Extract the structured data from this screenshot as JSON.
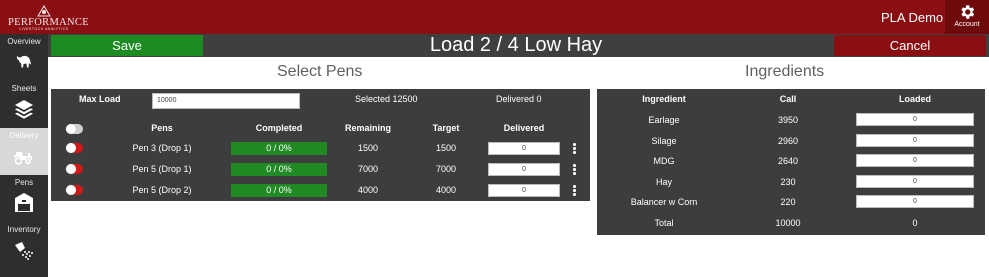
{
  "header": {
    "logo_text": "PERFORMANCE",
    "logo_sub": "LIVESTOCK ANALYTICS",
    "user_name": "PLA Demo",
    "account_label": "Account"
  },
  "sidebar": {
    "items": [
      {
        "label": "Overview",
        "icon": "bull-icon"
      },
      {
        "label": "Sheets",
        "icon": "layers-icon"
      },
      {
        "label": "Delivery",
        "icon": "tractor-icon",
        "active": true
      },
      {
        "label": "Pens",
        "icon": "barn-icon"
      },
      {
        "label": "Inventory",
        "icon": "grain-scoop-icon"
      }
    ]
  },
  "actionbar": {
    "save_label": "Save",
    "title": "Load 2 / 4 Low Hay",
    "cancel_label": "Cancel"
  },
  "pens_section": {
    "title": "Select Pens",
    "max_load_label": "Max Load",
    "max_load_value": "10000",
    "selected_text": "Selected 12500",
    "delivered_text": "Delivered 0",
    "columns": [
      "Pens",
      "Completed",
      "Remaining",
      "Target",
      "Delivered"
    ],
    "rows": [
      {
        "pen": "Pen 3 (Drop 1)",
        "completed": "0 / 0%",
        "remaining": "1500",
        "target": "1500",
        "delivered": "0"
      },
      {
        "pen": "Pen 5 (Drop 1)",
        "completed": "0 / 0%",
        "remaining": "7000",
        "target": "7000",
        "delivered": "0"
      },
      {
        "pen": "Pen 5 (Drop 2)",
        "completed": "0 / 0%",
        "remaining": "4000",
        "target": "4000",
        "delivered": "0"
      }
    ]
  },
  "ingredients_section": {
    "title": "Ingredients",
    "columns": [
      "Ingredient",
      "Call",
      "Loaded"
    ],
    "rows": [
      {
        "name": "Earlage",
        "call": "3950",
        "loaded": "0"
      },
      {
        "name": "Silage",
        "call": "2960",
        "loaded": "0"
      },
      {
        "name": "MDG",
        "call": "2640",
        "loaded": "0"
      },
      {
        "name": "Hay",
        "call": "230",
        "loaded": "0"
      },
      {
        "name": "Balancer w Corn",
        "call": "220",
        "loaded": "0"
      }
    ],
    "total": {
      "label": "Total",
      "call": "10000",
      "loaded": "0"
    }
  },
  "colors": {
    "brand_red": "#8a0f12",
    "save_green": "#1c8c22",
    "panel_gray": "#3d3d3d",
    "toggle_red": "#d01818"
  }
}
